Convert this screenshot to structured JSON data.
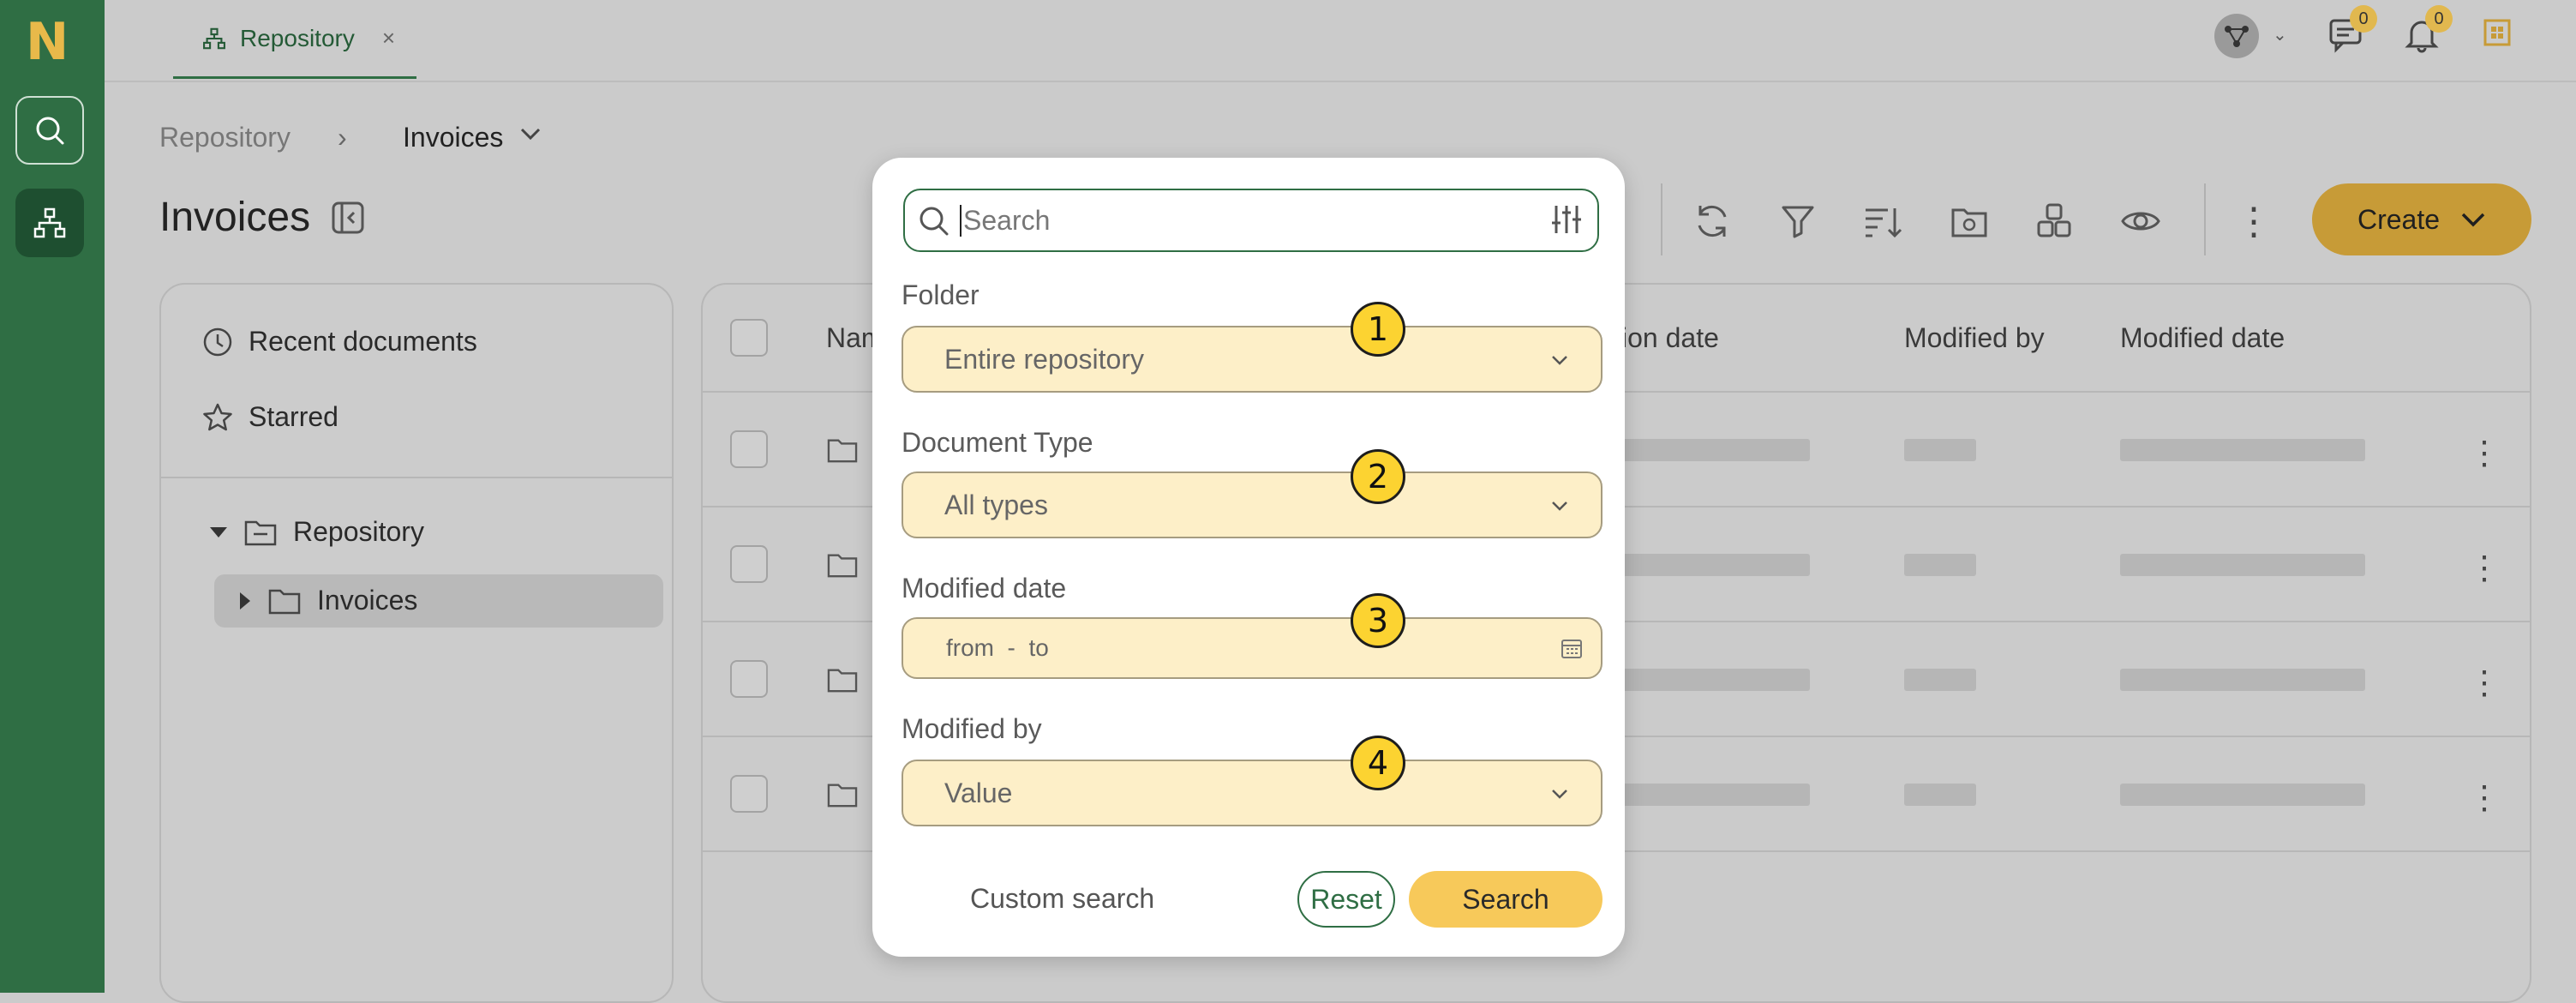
{
  "app": {
    "logo_letter": "N"
  },
  "topbar": {
    "tab_label": "Repository",
    "tab_close": "×",
    "notif_count": "0",
    "messages_count": "0"
  },
  "breadcrumb": {
    "root": "Repository",
    "sep": "›",
    "current": "Invoices"
  },
  "page": {
    "title": "Invoices"
  },
  "sidebar": {
    "recent": "Recent documents",
    "starred": "Starred",
    "tree_root": "Repository",
    "tree_child": "Invoices"
  },
  "toolbar": {
    "create_label": "Create"
  },
  "table": {
    "columns": [
      "Nam",
      "ion date",
      "Modified by",
      "Modified date"
    ]
  },
  "modal": {
    "search_placeholder": "Search",
    "folder_label": "Folder",
    "folder_value": "Entire repository",
    "doctype_label": "Document Type",
    "doctype_value": "All types",
    "date_label": "Modified date",
    "date_value": "from  -  to",
    "by_label": "Modified by",
    "by_value": "Value",
    "custom_search": "Custom search",
    "reset": "Reset",
    "search": "Search",
    "markers": [
      "1",
      "2",
      "3",
      "4"
    ]
  },
  "colors": {
    "rail": "#2f6e44",
    "accent": "#c79b37",
    "field_bg": "#fdefc8",
    "marker": "#fcd331"
  }
}
